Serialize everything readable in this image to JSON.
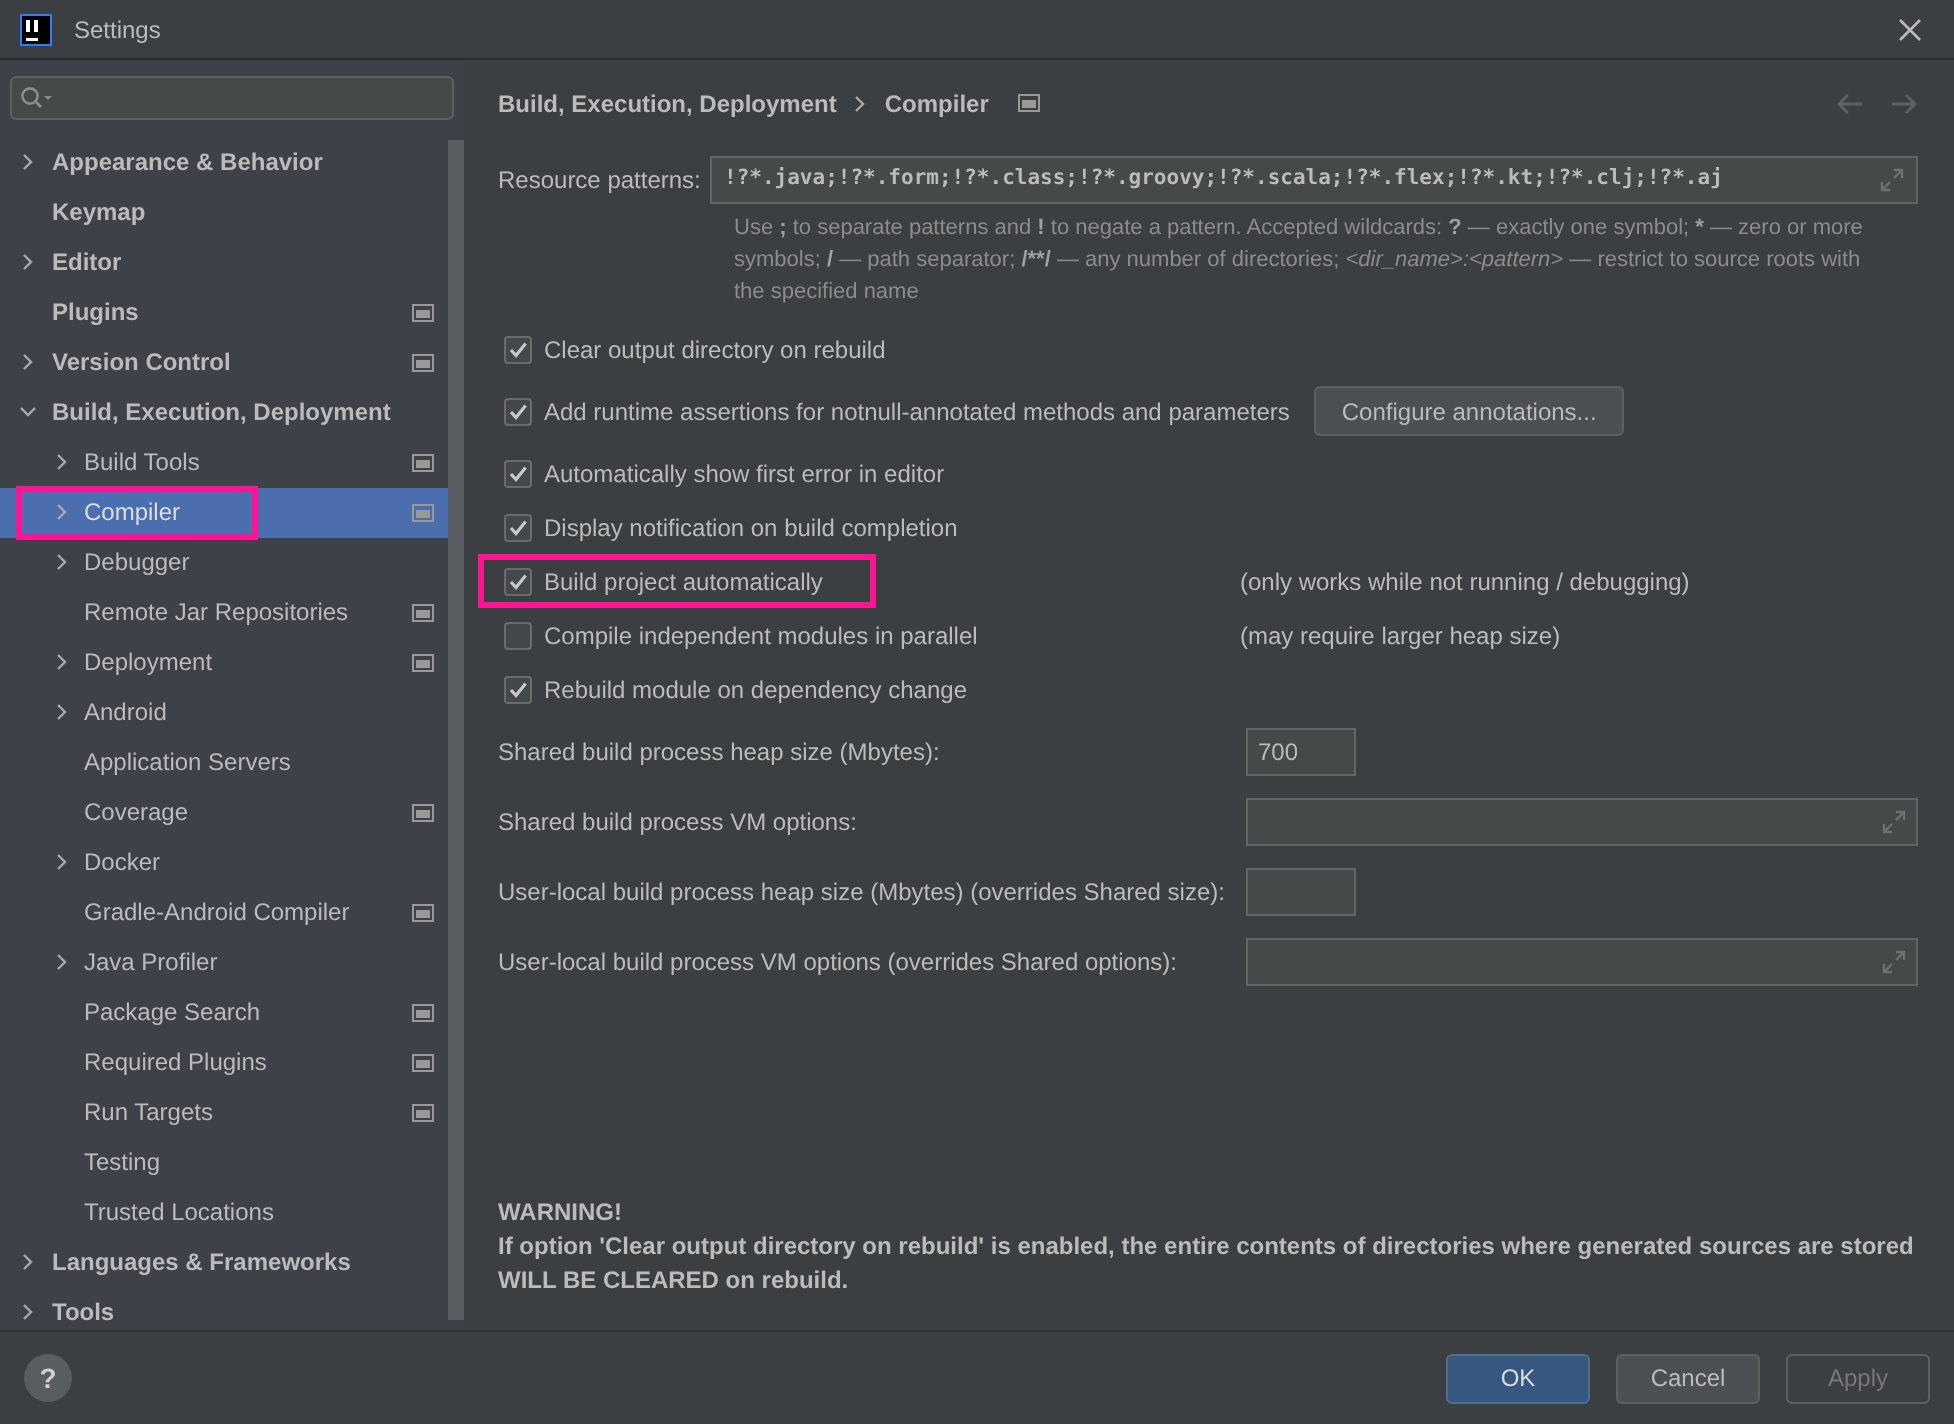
{
  "window": {
    "title": "Settings"
  },
  "sidebar": {
    "tree": [
      {
        "label": "Appearance & Behavior",
        "expandable": true,
        "expanded": false,
        "selected": false,
        "project_level": false,
        "highlighted": false
      },
      {
        "label": "Keymap",
        "expandable": false,
        "selected": false,
        "project_level": false,
        "highlighted": false
      },
      {
        "label": "Editor",
        "expandable": true,
        "expanded": false,
        "selected": false,
        "project_level": false,
        "highlighted": false
      },
      {
        "label": "Plugins",
        "expandable": false,
        "selected": false,
        "project_level": true,
        "highlighted": false
      },
      {
        "label": "Version Control",
        "expandable": true,
        "expanded": false,
        "selected": false,
        "project_level": true,
        "highlighted": false
      },
      {
        "label": "Build, Execution, Deployment",
        "expandable": true,
        "expanded": true,
        "selected": false,
        "project_level": false,
        "highlighted": false,
        "children": [
          {
            "label": "Build Tools",
            "expandable": true,
            "expanded": false,
            "selected": false,
            "project_level": true,
            "highlighted": false
          },
          {
            "label": "Compiler",
            "expandable": true,
            "expanded": false,
            "selected": true,
            "project_level": true,
            "highlighted": true
          },
          {
            "label": "Debugger",
            "expandable": true,
            "expanded": false,
            "selected": false,
            "project_level": false,
            "highlighted": false
          },
          {
            "label": "Remote Jar Repositories",
            "expandable": false,
            "selected": false,
            "project_level": true,
            "highlighted": false
          },
          {
            "label": "Deployment",
            "expandable": true,
            "expanded": false,
            "selected": false,
            "project_level": true,
            "highlighted": false
          },
          {
            "label": "Android",
            "expandable": true,
            "expanded": false,
            "selected": false,
            "project_level": false,
            "highlighted": false
          },
          {
            "label": "Application Servers",
            "expandable": false,
            "selected": false,
            "project_level": false,
            "highlighted": false
          },
          {
            "label": "Coverage",
            "expandable": false,
            "selected": false,
            "project_level": true,
            "highlighted": false
          },
          {
            "label": "Docker",
            "expandable": true,
            "expanded": false,
            "selected": false,
            "project_level": false,
            "highlighted": false
          },
          {
            "label": "Gradle-Android Compiler",
            "expandable": false,
            "selected": false,
            "project_level": true,
            "highlighted": false
          },
          {
            "label": "Java Profiler",
            "expandable": true,
            "expanded": false,
            "selected": false,
            "project_level": false,
            "highlighted": false
          },
          {
            "label": "Package Search",
            "expandable": false,
            "selected": false,
            "project_level": true,
            "highlighted": false
          },
          {
            "label": "Required Plugins",
            "expandable": false,
            "selected": false,
            "project_level": true,
            "highlighted": false
          },
          {
            "label": "Run Targets",
            "expandable": false,
            "selected": false,
            "project_level": true,
            "highlighted": false
          },
          {
            "label": "Testing",
            "expandable": false,
            "selected": false,
            "project_level": false,
            "highlighted": false
          },
          {
            "label": "Trusted Locations",
            "expandable": false,
            "selected": false,
            "project_level": false,
            "highlighted": false
          }
        ]
      },
      {
        "label": "Languages & Frameworks",
        "expandable": true,
        "expanded": false,
        "selected": false,
        "project_level": false,
        "highlighted": false
      },
      {
        "label": "Tools",
        "expandable": true,
        "expanded": false,
        "selected": false,
        "project_level": false,
        "highlighted": false
      }
    ]
  },
  "breadcrumb": {
    "items": [
      "Build, Execution, Deployment",
      "Compiler"
    ],
    "project_level": true
  },
  "resource_patterns": {
    "label": "Resource patterns:",
    "value": "!?*.java;!?*.form;!?*.class;!?*.groovy;!?*.scala;!?*.flex;!?*.kt;!?*.clj;!?*.aj",
    "help": [
      {
        "kind": "plain",
        "text": "Use "
      },
      {
        "kind": "bold",
        "text": ";"
      },
      {
        "kind": "plain",
        "text": " to separate patterns and "
      },
      {
        "kind": "bold",
        "text": "!"
      },
      {
        "kind": "plain",
        "text": " to negate a pattern. Accepted wildcards: "
      },
      {
        "kind": "bold",
        "text": "?"
      },
      {
        "kind": "plain",
        "text": " — exactly one symbol; "
      },
      {
        "kind": "bold",
        "text": "*"
      },
      {
        "kind": "plain",
        "text": " — zero or more symbols; "
      },
      {
        "kind": "bold",
        "text": "/"
      },
      {
        "kind": "plain",
        "text": " — path separator; "
      },
      {
        "kind": "bold",
        "text": "/**/"
      },
      {
        "kind": "plain",
        "text": " — any number of directories; "
      },
      {
        "kind": "italic",
        "text": "<dir_name>:<pattern>"
      },
      {
        "kind": "plain",
        "text": " — restrict to source roots with the specified name"
      }
    ]
  },
  "options": [
    {
      "kind": "checkbox",
      "label": "Clear output directory on rebuild",
      "checked": true,
      "highlighted": false
    },
    {
      "kind": "checkbox",
      "label": "Add runtime assertions for notnull-annotated methods and parameters",
      "checked": true,
      "highlighted": false,
      "button": "Configure annotations..."
    },
    {
      "kind": "checkbox",
      "label": "Automatically show first error in editor",
      "checked": true,
      "highlighted": false
    },
    {
      "kind": "checkbox",
      "label": "Display notification on build completion",
      "checked": true,
      "highlighted": false
    },
    {
      "kind": "checkbox",
      "label": "Build project automatically",
      "checked": true,
      "highlighted": true,
      "note": "(only works while not running / debugging)"
    },
    {
      "kind": "checkbox",
      "label": "Compile independent modules in parallel",
      "checked": false,
      "highlighted": false,
      "note": "(may require larger heap size)"
    },
    {
      "kind": "checkbox",
      "label": "Rebuild module on dependency change",
      "checked": true,
      "highlighted": false
    },
    {
      "kind": "short_field",
      "label": "Shared build process heap size (Mbytes):",
      "value": "700"
    },
    {
      "kind": "wide_field",
      "label": "Shared build process VM options:"
    },
    {
      "kind": "short_field",
      "label": "User-local build process heap size (Mbytes) (overrides Shared size):"
    },
    {
      "kind": "wide_field",
      "label": "User-local build process VM options (overrides Shared options):"
    }
  ],
  "warning": {
    "title": "WARNING!",
    "text": "If option 'Clear output directory on rebuild' is enabled, the entire contents of directories where generated sources are stored WILL BE CLEARED on rebuild."
  },
  "buttons": [
    {
      "label": "OK",
      "kind": "default",
      "disabled": false
    },
    {
      "label": "Cancel",
      "kind": "normal",
      "disabled": false
    },
    {
      "label": "Apply",
      "kind": "normal",
      "disabled": true
    }
  ],
  "help_button": "?"
}
